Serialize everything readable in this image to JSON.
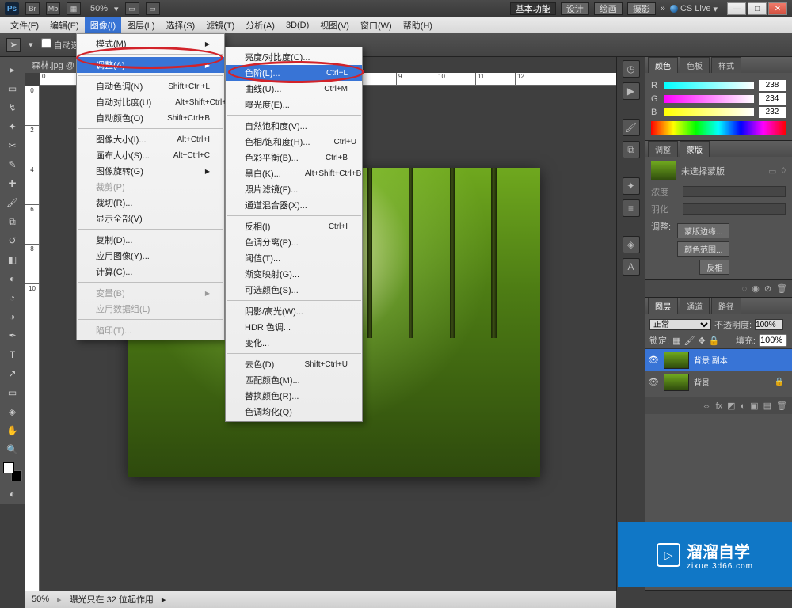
{
  "title_zoom": "50%",
  "workspace": {
    "basic": "基本功能",
    "design": "设计",
    "paint": "绘画",
    "photo": "摄影",
    "cslive": "CS Live"
  },
  "menubar": [
    "文件(F)",
    "编辑(E)",
    "图像(I)",
    "图层(L)",
    "选择(S)",
    "滤镜(T)",
    "分析(A)",
    "3D(D)",
    "视图(V)",
    "窗口(W)",
    "帮助(H)"
  ],
  "optbar": {
    "auto_select": "自动选"
  },
  "menu1": {
    "mode": "模式(M)",
    "adjust": "调整(A)",
    "auto_tone": "自动色调(N)",
    "auto_tone_sc": "Shift+Ctrl+L",
    "auto_contrast": "自动对比度(U)",
    "auto_contrast_sc": "Alt+Shift+Ctrl+L",
    "auto_color": "自动颜色(O)",
    "auto_color_sc": "Shift+Ctrl+B",
    "img_size": "图像大小(I)...",
    "img_size_sc": "Alt+Ctrl+I",
    "canvas_size": "画布大小(S)...",
    "canvas_size_sc": "Alt+Ctrl+C",
    "rotate": "图像旋转(G)",
    "crop": "裁剪(P)",
    "trim": "裁切(R)...",
    "reveal": "显示全部(V)",
    "duplicate": "复制(D)...",
    "apply": "应用图像(Y)...",
    "calc": "计算(C)...",
    "variables": "变量(B)",
    "datasets": "应用数据组(L)",
    "trap": "陷印(T)..."
  },
  "menu2": {
    "bc": "亮度/对比度(C)...",
    "levels": "色阶(L)...",
    "levels_sc": "Ctrl+L",
    "curves": "曲线(U)...",
    "curves_sc": "Ctrl+M",
    "exposure": "曝光度(E)...",
    "vibrance": "自然饱和度(V)...",
    "hsl": "色相/饱和度(H)...",
    "hsl_sc": "Ctrl+U",
    "balance": "色彩平衡(B)...",
    "balance_sc": "Ctrl+B",
    "bw": "黑白(K)...",
    "bw_sc": "Alt+Shift+Ctrl+B",
    "photo": "照片滤镜(F)...",
    "mixer": "通道混合器(X)...",
    "invert": "反相(I)",
    "invert_sc": "Ctrl+I",
    "poster": "色调分离(P)...",
    "threshold": "阈值(T)...",
    "gradmap": "渐变映射(G)...",
    "selcolor": "可选颜色(S)...",
    "shadows": "阴影/高光(W)...",
    "hdr": "HDR 色调...",
    "variations": "变化...",
    "desat": "去色(D)",
    "desat_sc": "Shift+Ctrl+U",
    "match": "匹配颜色(M)...",
    "replace": "替换颜色(R)...",
    "equalize": "色调均化(Q)"
  },
  "panels": {
    "color_tab": "颜色",
    "swatch_tab": "色板",
    "style_tab": "样式",
    "r": "R",
    "g": "G",
    "b": "B",
    "rv": "238",
    "gv": "234",
    "bv": "232",
    "adjust_tab": "调整",
    "mask_tab": "蒙版",
    "mask_kind": "未选择蒙版",
    "density": "浓度",
    "feather": "羽化",
    "refine": "调整:",
    "mask_edge": "蒙版边缘...",
    "color_range": "颜色范围...",
    "invert_btn": "反相",
    "layers_tab": "图层",
    "channels_tab": "通道",
    "paths_tab": "路径",
    "blend": "正常",
    "opacity_lbl": "不透明度:",
    "opacity": "100%",
    "lock_lbl": "锁定:",
    "fill_lbl": "填充:",
    "fill": "100%",
    "layer1": "背景 副本",
    "layer2": "背景"
  },
  "status": {
    "zoom": "50%",
    "info": "曝光只在 32 位起作用"
  },
  "tab": "森林.jpg @",
  "watermark": {
    "big": "溜溜自学",
    "small": "zixue.3d66.com"
  }
}
